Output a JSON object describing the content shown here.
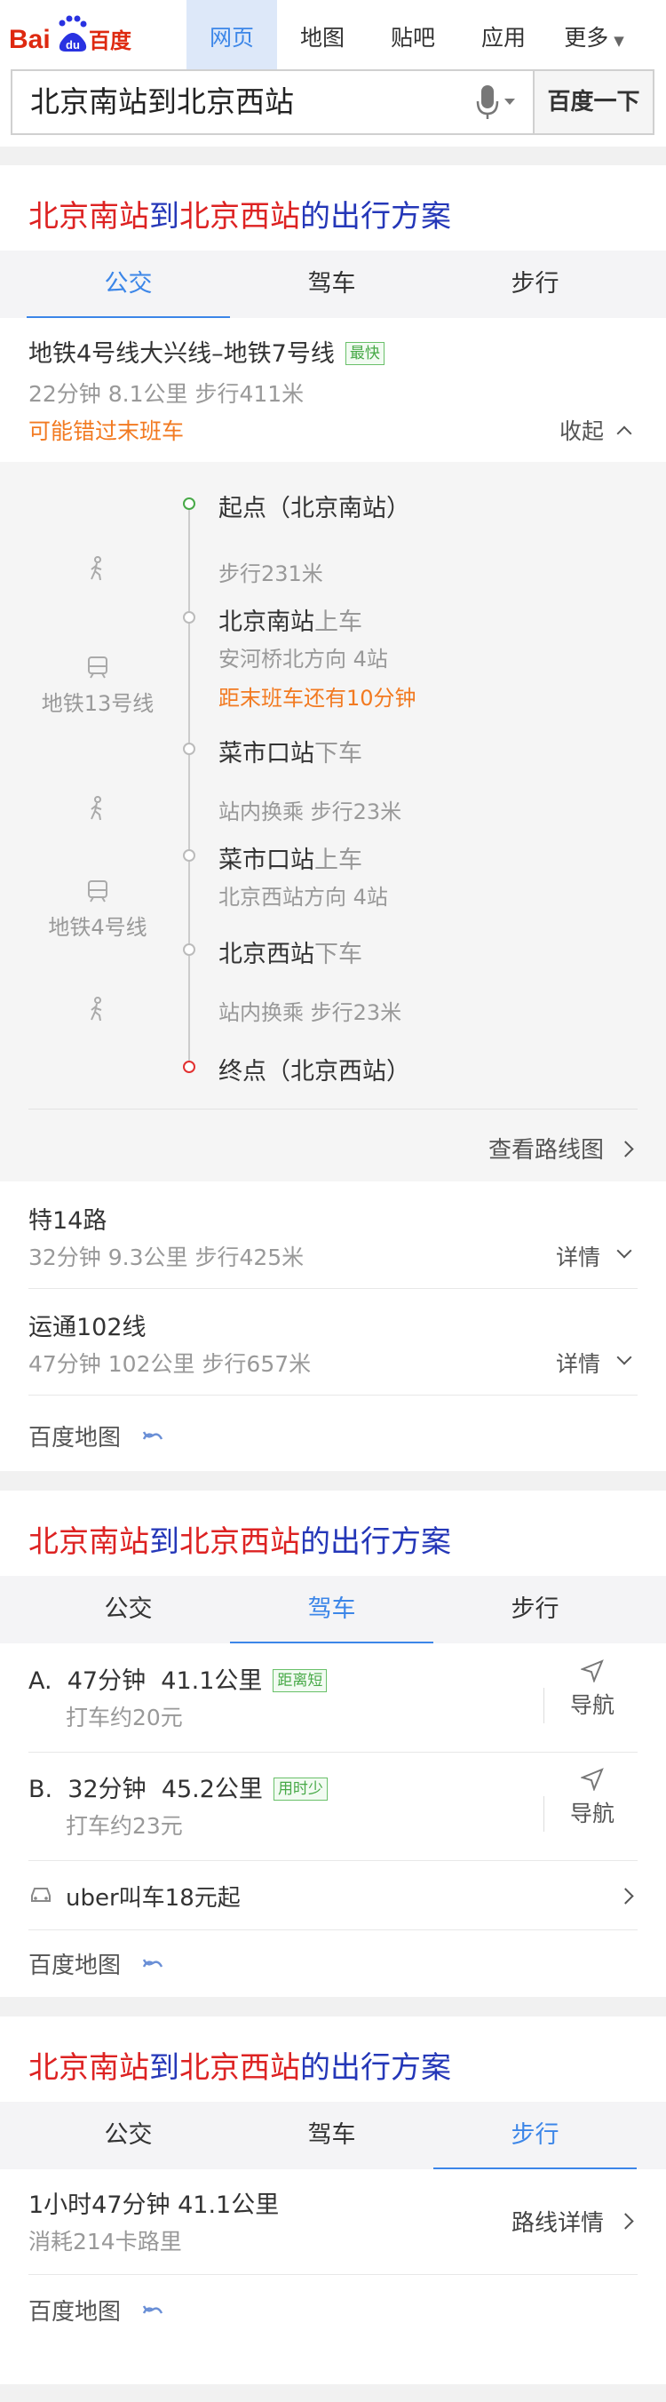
{
  "header": {
    "logo_text": "Bai百度",
    "nav": [
      "网页",
      "地图",
      "贴吧",
      "应用",
      "更多"
    ],
    "search_value": "北京南站到北京西站",
    "search_button": "百度一下"
  },
  "title": {
    "origin": "北京南站",
    "to": "到",
    "dest": "北京西站",
    "suffix": "的出行方案"
  },
  "card1": {
    "tabs": [
      "公交",
      "驾车",
      "步行"
    ],
    "route1": {
      "name": "地铁4号线大兴线–地铁7号线",
      "badge": "最快",
      "meta": "22分钟    8.1公里    步行411米",
      "warning": "可能错过末班车",
      "collapse": "收起"
    },
    "timeline": {
      "start": "起点（北京南站）",
      "walk1": "步行231米",
      "board1_station": "北京南站",
      "board1_action": "上车",
      "board1_dir": "安河桥北方向   4站",
      "board1_last": "距末班车还有10分钟",
      "line1": "地铁13号线",
      "alight1_station": "菜市口站",
      "alight1_action": "下车",
      "transfer1": "站内换乘   步行23米",
      "board2_station": "菜市口站",
      "board2_action": "上车",
      "board2_dir": "北京西站方向   4站",
      "line2": "地铁4号线",
      "alight2_station": "北京西站",
      "alight2_action": "下车",
      "transfer2": "站内换乘   步行23米",
      "end": "终点（北京西站）",
      "view_map": "查看路线图"
    },
    "route2": {
      "name": "特14路",
      "meta": "32分钟    9.3公里    步行425米",
      "detail": "详情"
    },
    "route3": {
      "name": "运通102线",
      "meta": "47分钟    102公里    步行657米",
      "detail": "详情"
    },
    "footer": "百度地图"
  },
  "card2": {
    "tabs": [
      "公交",
      "驾车",
      "步行"
    ],
    "optA": {
      "label": "A.",
      "time": "47分钟",
      "dist": "41.1公里",
      "badge": "距离短",
      "taxi": "打车约20元",
      "nav": "导航"
    },
    "optB": {
      "label": "B.",
      "time": "32分钟",
      "dist": "45.2公里",
      "badge": "用时少",
      "taxi": "打车约23元",
      "nav": "导航"
    },
    "uber": "uber叫车18元起",
    "footer": "百度地图"
  },
  "card3": {
    "tabs": [
      "公交",
      "驾车",
      "步行"
    ],
    "walk_summary": "1小时47分钟   41.1公里",
    "calories": "消耗214卡路里",
    "detail": "路线详情",
    "footer": "百度地图"
  },
  "colors": {
    "accent": "#3c86e8",
    "red": "#dd2222",
    "navy": "#2437b8",
    "orange": "#f27a21",
    "green": "#47a947"
  }
}
